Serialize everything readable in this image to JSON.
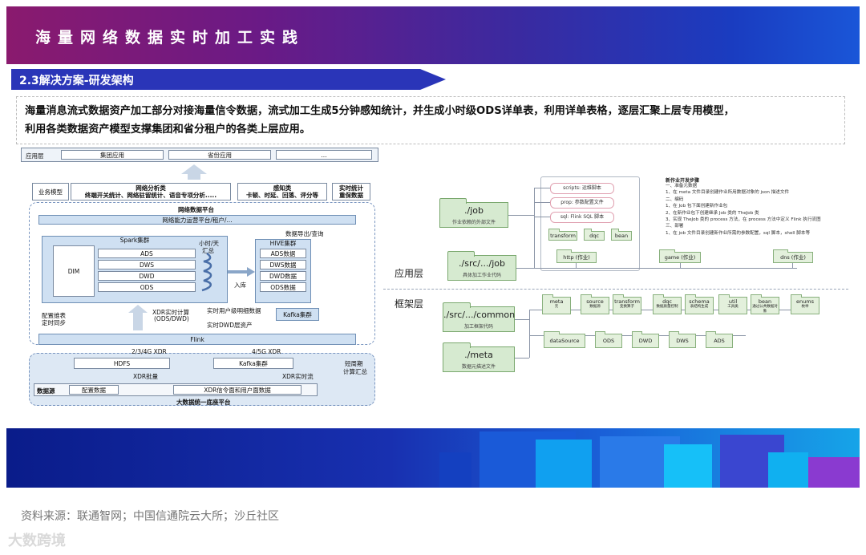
{
  "header": {
    "title": "海量网络数据实时加工实践"
  },
  "section": {
    "label": "2.3解决方案-研发架构"
  },
  "description": {
    "line1": "海量消息流式数据资产加工部分对接海量信令数据，流式加工生成5分钟感知统计，并生成小时级ODS详单表，利用详单表格，逐层汇聚上层专用模型，",
    "line2": "利用各类数据资产模型支撑集团和省分租户的各类上层应用。"
  },
  "left_diagram": {
    "app_layer": "应用层",
    "app_group": "集团应用",
    "app_prov": "省份应用",
    "app_more": "...",
    "biz_model": "业务模型",
    "net_analysis": "网络分析类",
    "net_analysis_sub": "终端开关统计、网络驻留统计、语音专项分析.....",
    "perception": "感知类",
    "perception_sub": "卡顿、时延、回落、评分等",
    "realtime_stat": "实时统计",
    "realtime_sub": "重保数据",
    "platform_title": "网络数据平台",
    "capacity": "网络能力运营平台/租户/...",
    "spark": "Spark集群",
    "dim": "DIM",
    "ads": "ADS",
    "dws": "DWS",
    "dwd": "DWD",
    "ods": "ODS",
    "hour_day": "小时/天",
    "summary": "汇总",
    "hive": "HIVE集群",
    "hive_ads": "ADS数据",
    "hive_dws": "DWS数据",
    "hive_dwd": "DWD数据",
    "hive_ods": "ODS数据",
    "export": "数据导出/查询",
    "into_db": "入库",
    "config_sync1": "配置维表",
    "config_sync2": "定时同步",
    "xdr_calc1": "XDR实时计算",
    "xdr_calc2": "(ODS/DWD)",
    "realtime_user": "实时用户级明细数据",
    "realtime_dwd": "实时DWD层资产",
    "kafka": "Kafka集群",
    "flink": "Flink",
    "xdr_234g": "2/3/4G XDR",
    "xdr_45g": "4/5G XDR",
    "hdfs": "HDFS",
    "kafka2": "Kafka集群",
    "short_cycle1": "短周期",
    "short_cycle2": "计算汇总",
    "xdr_batch": "XDR批量",
    "xdr_realtime": "XDR实时流",
    "data_source": "数据源",
    "config_data": "配置数据",
    "xdr_data": "XDR信令面和用户面数据",
    "bigdata": "大数据统一底座平台"
  },
  "right_diagram": {
    "job": "./job",
    "job_sub": "作业依赖的外部文件",
    "src_job": "./src/.../job",
    "src_job_sub": "具体加工作业代码",
    "src_common": "./src/.../common",
    "src_common_sub": "加工框架代码",
    "meta": "./meta",
    "meta_sub": "数据元描述文件",
    "app_layer": "应用层",
    "frame_layer": "框架层",
    "scripts": "scripts: 运维脚本",
    "prop": "prop: 参数配置文件",
    "sql": "sql: Flink SQL 脚本",
    "transform": "transform",
    "dqc": "dqc",
    "bean": "bean",
    "http": "http (作业)",
    "game": "game (作业)",
    "dns": "dns (作业)",
    "steps_title": "新作业开发步骤",
    "steps": [
      "一、准备元数据",
      "1、在 meta 文件目录创建作业所用数据对象的 json 描述文件",
      "二、编码",
      "1、在 Job 包下面创建新作业包",
      "2、在新作业包下创建继承 Job 类的 TheJob 类",
      "3、实现 TheJob 类的 process 方法，在 process 方法中定义 Flink 执行流图",
      "三、部署",
      "1、在 job 文件目录创建新作业所需的参数配置，sql 脚本，shell 脚本等"
    ],
    "common_items": [
      {
        "name": "meta",
        "sub": "元"
      },
      {
        "name": "source",
        "sub": "数据源"
      },
      {
        "name": "transform",
        "sub": "变换算子"
      },
      {
        "name": "dqc",
        "sub": "数据质量控制"
      },
      {
        "name": "schema",
        "sub": "表结构生成"
      },
      {
        "name": "util",
        "sub": "工具类"
      },
      {
        "name": "bean",
        "sub": "通过公共数据对象"
      },
      {
        "name": "enums",
        "sub": "枚举"
      }
    ],
    "meta_items": [
      "dataSource",
      "ODS",
      "DWD",
      "DWS",
      "ADS"
    ]
  },
  "footer": {
    "source": "资料来源：联通智网；中国信通院云大所；沙丘社区",
    "logo": "大数跨境"
  }
}
